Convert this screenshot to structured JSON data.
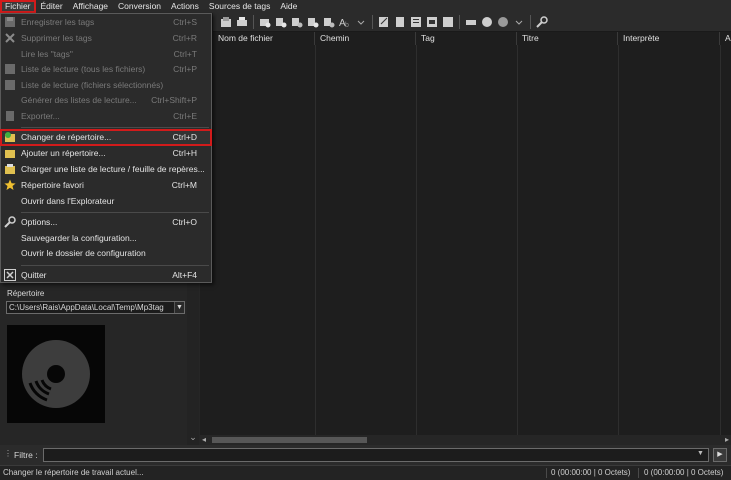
{
  "menubar": {
    "items": [
      "Fichier",
      "Éditer",
      "Affichage",
      "Conversion",
      "Actions",
      "Sources de tags",
      "Aide"
    ]
  },
  "file_menu": {
    "items": [
      {
        "label": "Enregistrer les tags",
        "shortcut": "Ctrl+S",
        "enabled": false,
        "icon": "save-icon"
      },
      {
        "label": "Supprimer les tags",
        "shortcut": "Ctrl+R",
        "enabled": false,
        "icon": "remove-tags-icon"
      },
      {
        "label": "Lire les \"tags\"",
        "shortcut": "Ctrl+T",
        "enabled": false,
        "icon": ""
      },
      {
        "label": "Liste de lecture (tous les fichiers)",
        "shortcut": "Ctrl+P",
        "enabled": false,
        "icon": "playlist-icon"
      },
      {
        "label": "Liste de lecture (fichiers sélectionnés)",
        "shortcut": "",
        "enabled": false,
        "icon": "playlist-icon"
      },
      {
        "label": "Générer des listes de lecture...",
        "shortcut": "Ctrl+Shift+P",
        "enabled": false,
        "icon": ""
      },
      {
        "label": "Exporter...",
        "shortcut": "Ctrl+E",
        "enabled": false,
        "icon": "export-icon"
      },
      {
        "label": "Changer de répertoire...",
        "shortcut": "Ctrl+D",
        "enabled": true,
        "icon": "change-folder-icon",
        "highlighted": true
      },
      {
        "label": "Ajouter un répertoire...",
        "shortcut": "Ctrl+H",
        "enabled": true,
        "icon": "add-folder-icon"
      },
      {
        "label": "Charger une liste de lecture / feuille de repères...",
        "shortcut": "",
        "enabled": true,
        "icon": "load-playlist-icon"
      },
      {
        "label": "Répertoire favori",
        "shortcut": "Ctrl+M",
        "enabled": true,
        "icon": "star-icon"
      },
      {
        "label": "Ouvrir dans l'Explorateur",
        "shortcut": "",
        "enabled": true,
        "icon": ""
      },
      {
        "label": "Options...",
        "shortcut": "Ctrl+O",
        "enabled": true,
        "icon": "wrench-icon"
      },
      {
        "label": "Sauvegarder la configuration...",
        "shortcut": "",
        "enabled": true,
        "icon": ""
      },
      {
        "label": "Ouvrir le dossier de configuration",
        "shortcut": "",
        "enabled": true,
        "icon": ""
      },
      {
        "label": "Quitter",
        "shortcut": "Alt+F4",
        "enabled": true,
        "icon": "close-icon"
      }
    ]
  },
  "grid": {
    "columns": [
      "Nom de fichier",
      "Chemin",
      "Tag",
      "Titre",
      "Interprète",
      "A"
    ]
  },
  "left_panel": {
    "directory_label": "Répertoire",
    "directory_value": "C:\\Users\\Rais\\AppData\\Local\\Temp\\Mp3tag"
  },
  "filter": {
    "label": "Filtre :",
    "value": ""
  },
  "status": {
    "text": "Changer le répertoire de travail actuel...",
    "selected": "0 (00:00:00 | 0 Octets)",
    "total": "0 (00:00:00 | 0 Octets)"
  },
  "colors": {
    "highlight": "#d21b1b",
    "background": "#1e1e1e"
  }
}
